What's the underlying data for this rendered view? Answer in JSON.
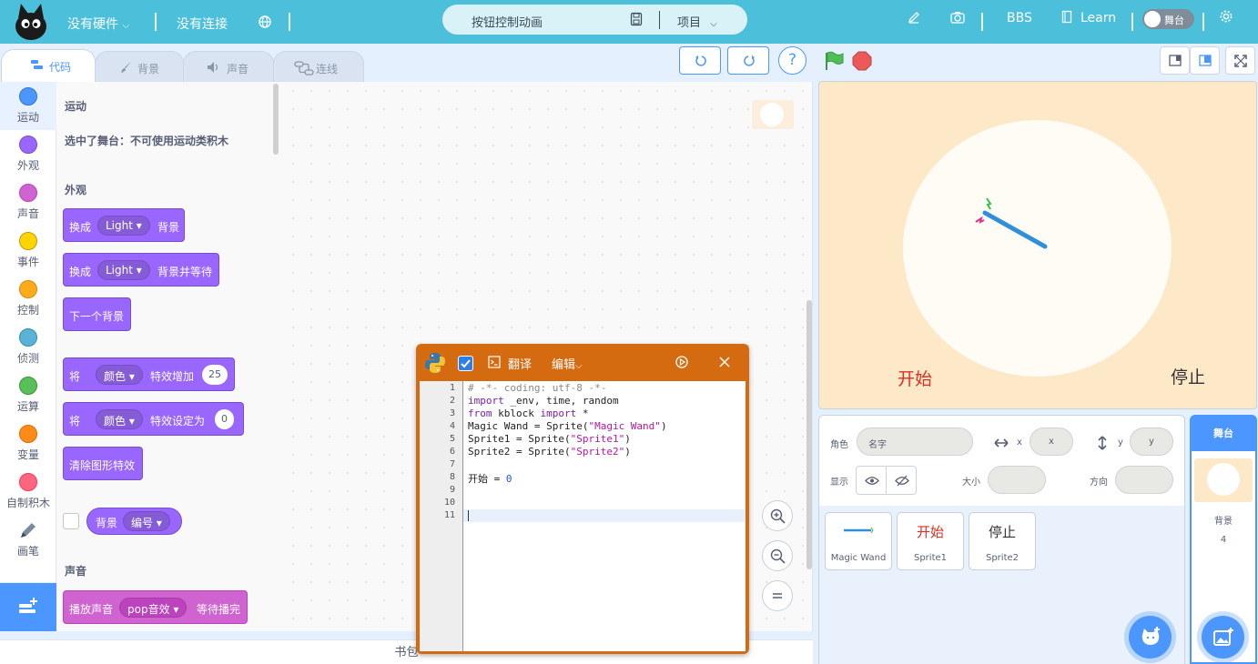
{
  "colors": {
    "topbar": "#4cc0db",
    "accent": "#4c97ff",
    "looks": "#9966ff",
    "sound": "#cf63cf",
    "python_window": "#d56b10"
  },
  "menu": {
    "hardware": "没有硬件",
    "connection": "没有连接",
    "project_title": "按钮控制动画",
    "project_menu": "项目",
    "bbs": "BBS",
    "learn": "Learn",
    "stage_toggle": "舞台"
  },
  "tabs": [
    {
      "label": "代码",
      "icon": "code-icon"
    },
    {
      "label": "背景",
      "icon": "brush-icon"
    },
    {
      "label": "声音",
      "icon": "speaker-icon"
    },
    {
      "label": "连线",
      "icon": "wire-icon"
    }
  ],
  "categories": [
    {
      "label": "运动",
      "color": "#4c97ff"
    },
    {
      "label": "外观",
      "color": "#9966ff"
    },
    {
      "label": "声音",
      "color": "#cf63cf"
    },
    {
      "label": "事件",
      "color": "#ffd500"
    },
    {
      "label": "控制",
      "color": "#ffab19"
    },
    {
      "label": "侦测",
      "color": "#5cb1d6"
    },
    {
      "label": "运算",
      "color": "#59c059"
    },
    {
      "label": "变量",
      "color": "#ff8c1a"
    },
    {
      "label": "自制积木",
      "color": "#ff6680"
    },
    {
      "label": "画笔",
      "color": "#0fbd8c"
    }
  ],
  "palette": {
    "motion_heading": "运动",
    "motion_note": "选中了舞台：不可使用运动类积木",
    "looks_heading": "外观",
    "switch_backdrop": {
      "word1": "换成",
      "value": "Light",
      "word2": "背景"
    },
    "switch_backdrop_wait": {
      "word1": "换成",
      "value": "Light",
      "word2": "背景并等待"
    },
    "next_backdrop": "下一个背景",
    "change_effect": {
      "word1": "将",
      "value": "颜色",
      "word2": "特效增加",
      "num": "25"
    },
    "set_effect": {
      "word1": "将",
      "value": "颜色",
      "word2": "特效设定为",
      "num": "0"
    },
    "clear_effects": "清除图形特效",
    "backdrop_reporter": {
      "word1": "背景",
      "value": "编号"
    },
    "sound_heading": "声音",
    "play_sound": {
      "word1": "播放声音",
      "value": "pop音效",
      "word2": "等待播完"
    }
  },
  "backpack": "书包",
  "python": {
    "translate": "翻译",
    "edit": "编辑",
    "lines": [
      {
        "n": "1",
        "t": "# -*- coding: utf-8 -*-"
      },
      {
        "n": "2",
        "t": "import _env, time, random"
      },
      {
        "n": "3",
        "t": "from kblock import *"
      },
      {
        "n": "4",
        "t": "Magic Wand = Sprite(\"Magic Wand\")"
      },
      {
        "n": "5",
        "t": "Sprite1 = Sprite(\"Sprite1\")"
      },
      {
        "n": "6",
        "t": "Sprite2 = Sprite(\"Sprite2\")"
      },
      {
        "n": "7",
        "t": ""
      },
      {
        "n": "8",
        "t": "开始 = 0"
      },
      {
        "n": "9",
        "t": ""
      },
      {
        "n": "10",
        "t": ""
      },
      {
        "n": "11",
        "t": ""
      }
    ]
  },
  "stage": {
    "start_text": "开始",
    "stop_text": "停止"
  },
  "sprite_info": {
    "sprite_label": "角色",
    "name_placeholder": "名字",
    "x_label": "x",
    "x_placeholder": "x",
    "y_label": "y",
    "y_placeholder": "y",
    "show_label": "显示",
    "size_label": "大小",
    "direction_label": "方向"
  },
  "sprites": [
    {
      "name": "Magic Wand",
      "title": ""
    },
    {
      "name": "Sprite1",
      "title": "开始"
    },
    {
      "name": "Sprite2",
      "title": "停止"
    }
  ],
  "stage_panel": {
    "header": "舞台",
    "backdrop_label": "背景",
    "backdrop_count": "4"
  }
}
